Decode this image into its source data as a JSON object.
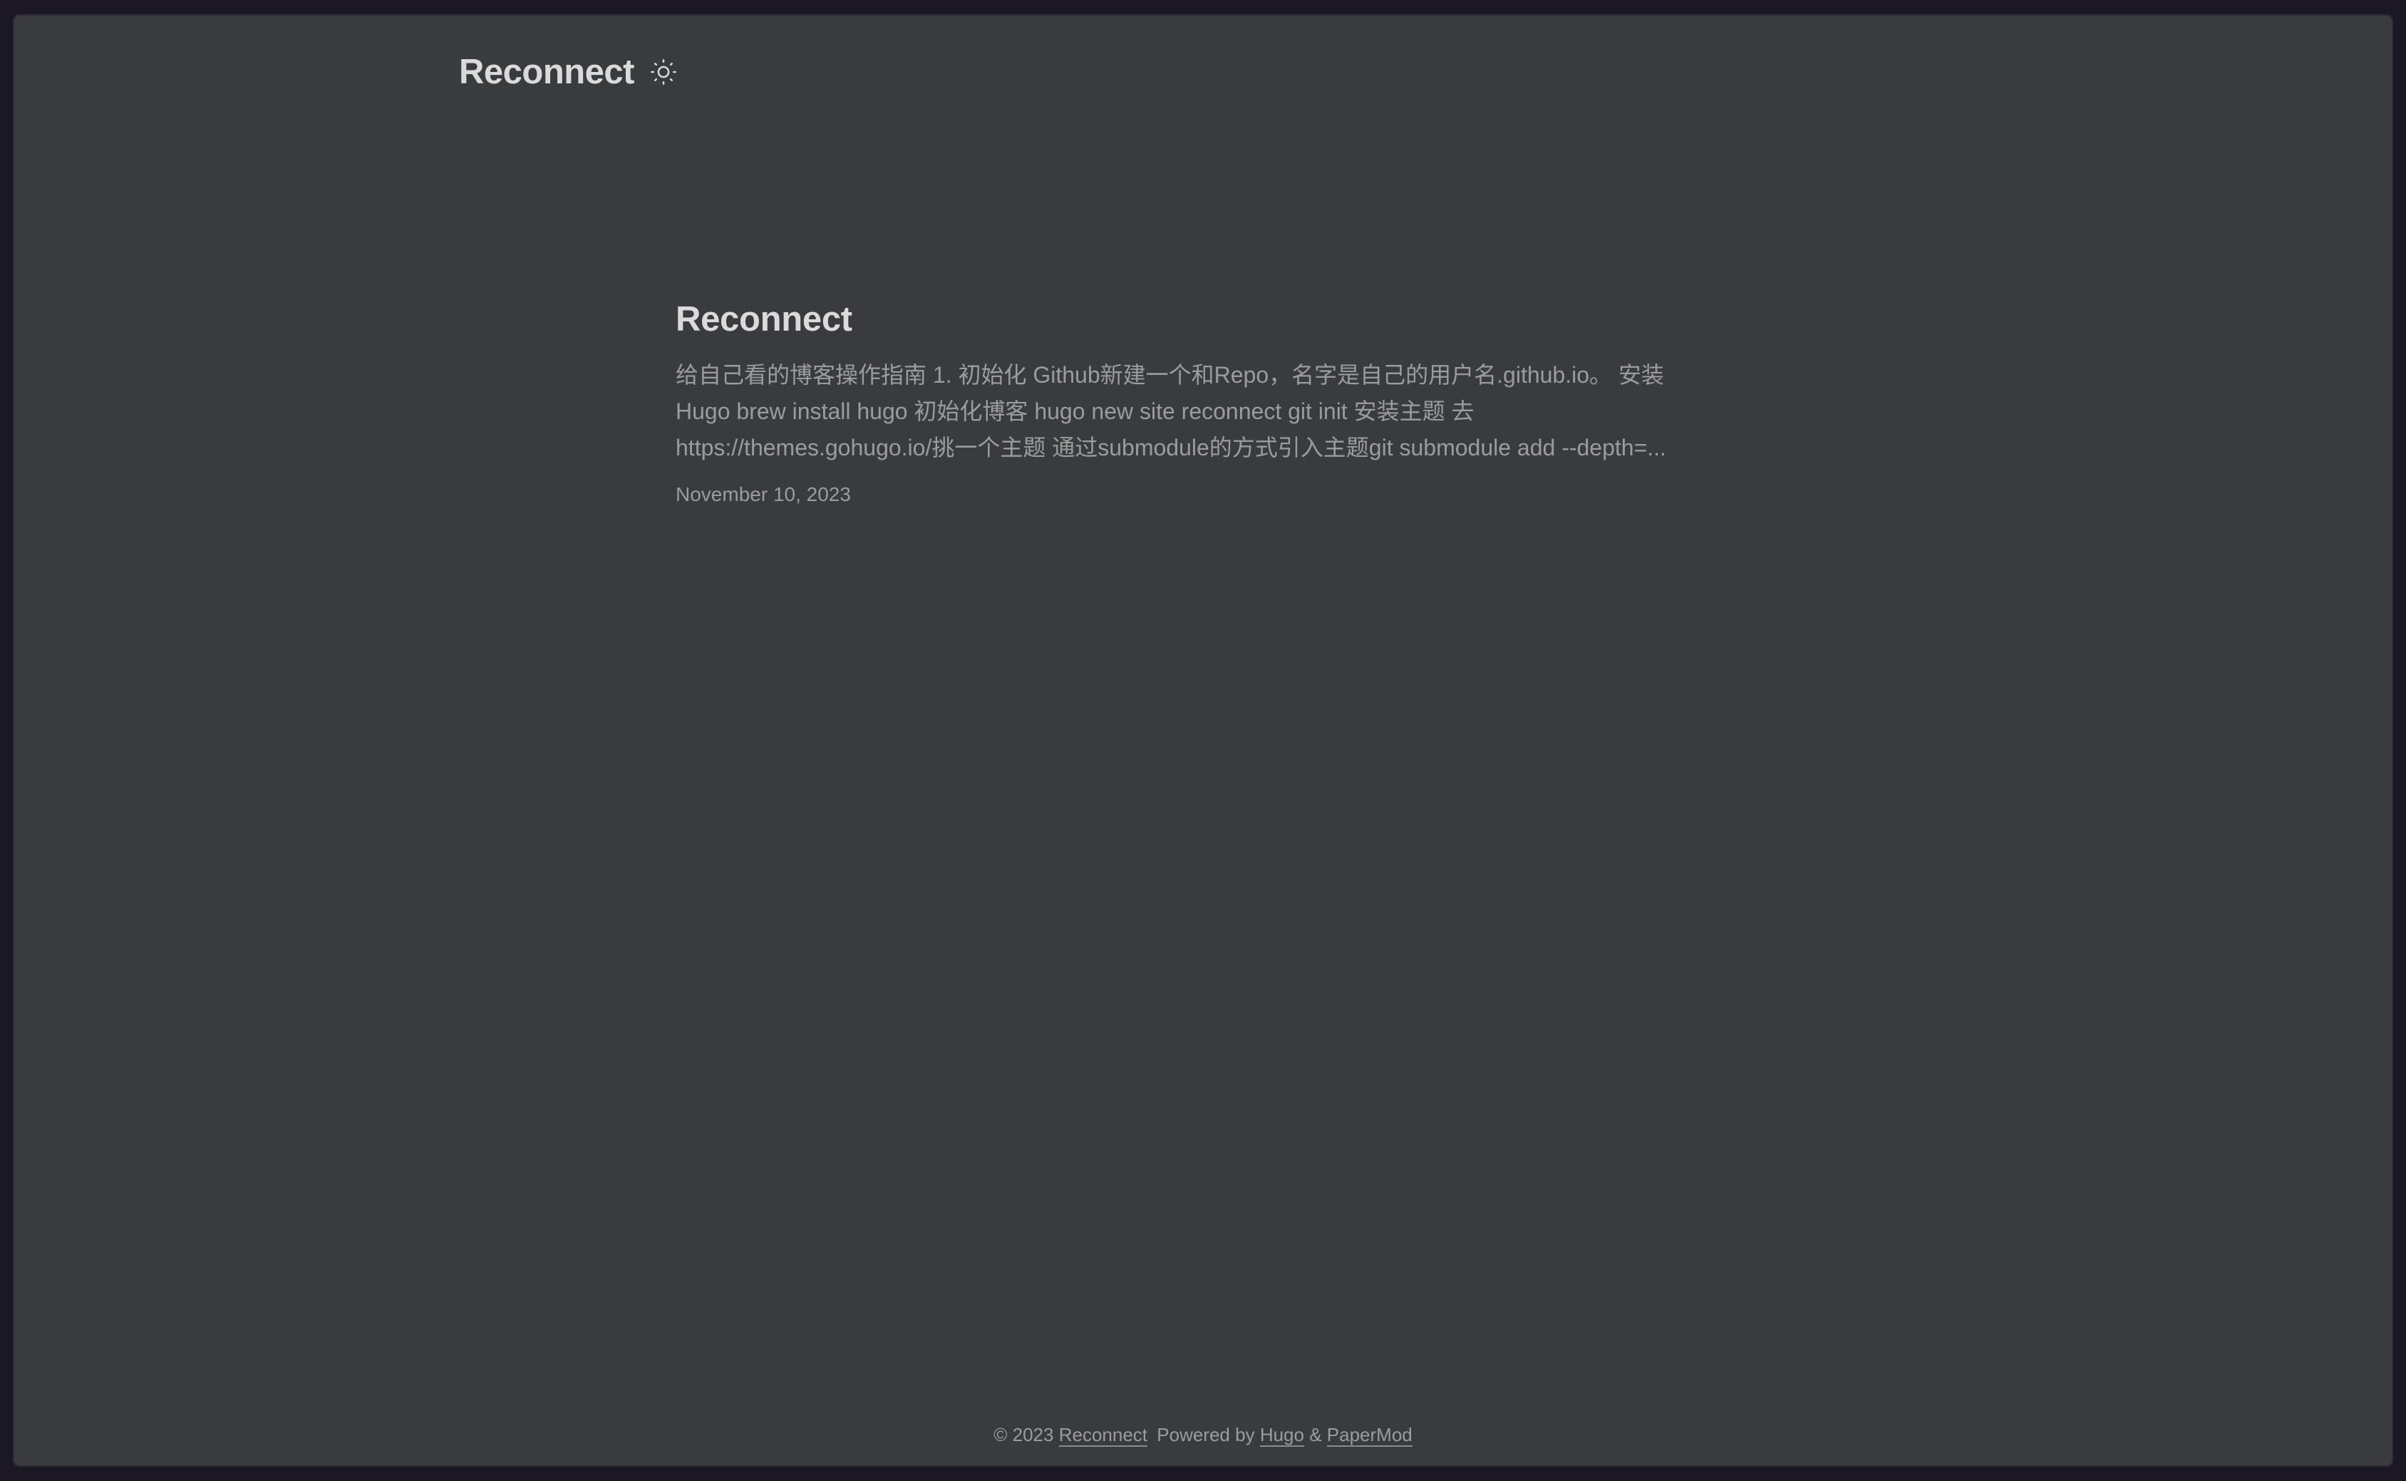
{
  "header": {
    "logo_text": "Reconnect",
    "theme_toggle_icon": "sun-icon"
  },
  "post": {
    "title": "Reconnect",
    "summary_lines": [
      "给自己看的博客操作指南 1. 初始化 Github新建一个和Repo，名字是自己的用户名.github.io。 安装",
      "Hugo brew install hugo 初始化博客 hugo new site reconnect git init 安装主题 去",
      "https://themes.gohugo.io/挑一个主题 通过submodule的方式引入主题git submodule add --depth=..."
    ],
    "date": "November 10, 2023"
  },
  "footer": {
    "copyright": "© 2023",
    "site_link": "Reconnect",
    "powered_by": "Powered by",
    "hugo_link": "Hugo",
    "amp": "&",
    "theme_link": "PaperMod"
  },
  "colors": {
    "background": "#3a3b3e",
    "primary_text": "#dadadb",
    "secondary_text": "#9b9c9d",
    "outer_frame": "#1b1725"
  }
}
